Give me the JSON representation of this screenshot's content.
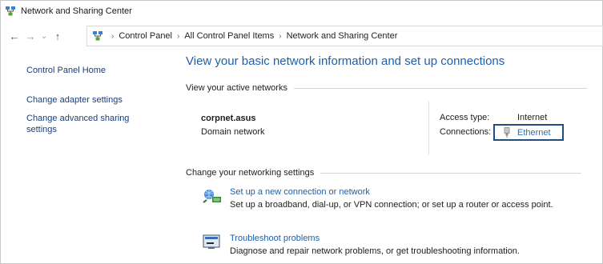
{
  "window": {
    "title": "Network and Sharing Center"
  },
  "nav": {
    "back": "←",
    "forward": "→",
    "recent": "⌄",
    "up": "↑"
  },
  "address": {
    "sep": "›",
    "crumbs": [
      "Control Panel",
      "All Control Panel Items",
      "Network and Sharing Center"
    ]
  },
  "left": {
    "home": "Control Panel Home",
    "adapter": "Change adapter settings",
    "advanced": "Change advanced sharing settings"
  },
  "main": {
    "title": "View your basic network information and set up connections",
    "active_header": "View your active networks",
    "network": {
      "name": "corpnet.asus",
      "type": "Domain network",
      "access_label": "Access type:",
      "access_value": "Internet",
      "connections_label": "Connections:",
      "connections_value": "Ethernet"
    },
    "change_header": "Change your networking settings",
    "tasks": [
      {
        "link": "Set up a new connection or network",
        "desc": "Set up a broadband, dial-up, or VPN connection; or set up a router or access point."
      },
      {
        "link": "Troubleshoot problems",
        "desc": "Diagnose and repair network problems, or get troubleshooting information."
      }
    ]
  },
  "colors": {
    "link": "#1f5fa8",
    "highlight_box": "#1f4e80"
  },
  "icons": {
    "app": "network-sharing-icon",
    "address": "control-panel-icon",
    "ethernet": "ethernet-icon",
    "setup": "network-setup-icon",
    "troubleshoot": "troubleshoot-icon"
  }
}
